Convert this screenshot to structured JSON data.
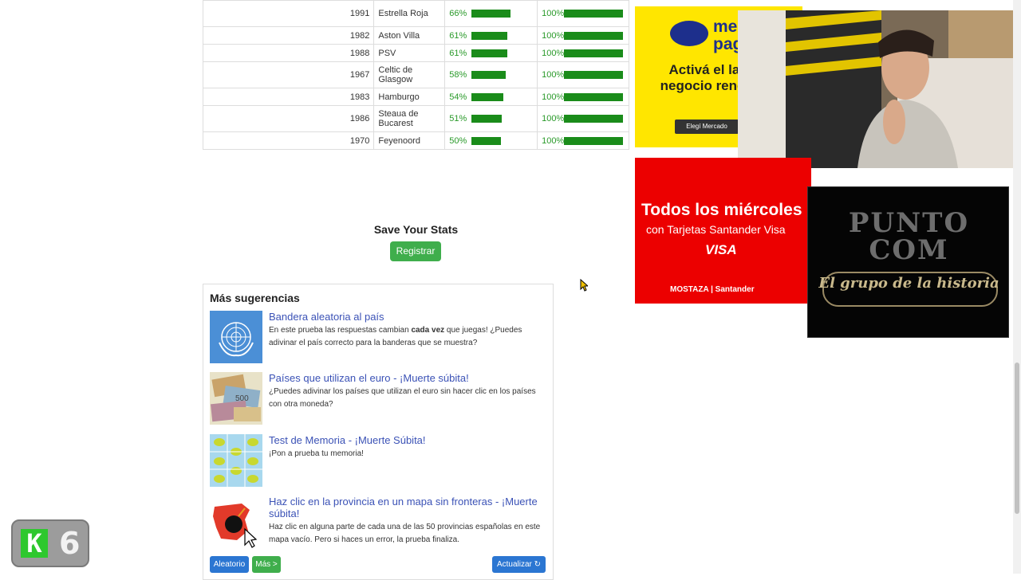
{
  "stats_table": {
    "rows": [
      {
        "year": "1991",
        "team": "Estrella Roja",
        "pct1": "66%",
        "pct1_value": 66,
        "pct2": "100%",
        "pct2_value": 100
      },
      {
        "year": "1982",
        "team": "Aston Villa",
        "pct1": "61%",
        "pct1_value": 61,
        "pct2": "100%",
        "pct2_value": 100
      },
      {
        "year": "1988",
        "team": "PSV",
        "pct1": "61%",
        "pct1_value": 61,
        "pct2": "100%",
        "pct2_value": 100
      },
      {
        "year": "1967",
        "team": "Celtic de Glasgow",
        "pct1": "58%",
        "pct1_value": 58,
        "pct2": "100%",
        "pct2_value": 100
      },
      {
        "year": "1983",
        "team": "Hamburgo",
        "pct1": "54%",
        "pct1_value": 54,
        "pct2": "100%",
        "pct2_value": 100
      },
      {
        "year": "1986",
        "team": "Steaua de Bucarest",
        "pct1": "51%",
        "pct1_value": 51,
        "pct2": "100%",
        "pct2_value": 100
      },
      {
        "year": "1970",
        "team": "Feyenoord",
        "pct1": "50%",
        "pct1_value": 50,
        "pct2": "100%",
        "pct2_value": 100
      }
    ]
  },
  "save": {
    "title": "Save Your Stats",
    "register_label": "Registrar"
  },
  "suggestions": {
    "heading": "Más sugerencias",
    "items": [
      {
        "title": "Bandera aleatoria al país",
        "desc_pre": "En este prueba las respuestas cambian ",
        "desc_bold": "cada vez",
        "desc_post": " que juegas! ¿Puedes adivinar el país correcto para la banderas que se muestra?"
      },
      {
        "title": "Países que utilizan el euro - ¡Muerte súbita!",
        "desc": "¿Puedes adivinar los países que utilizan el euro sin hacer clic en los países con otra moneda?"
      },
      {
        "title": "Test de Memoria - ¡Muerte Súbita!",
        "desc": "¡Pon a prueba tu memoria!"
      },
      {
        "title": "Haz clic en la provincia en un mapa sin fronteras - ¡Muerte súbita!",
        "desc": "Haz clic en alguna parte de cada una de las 50 provincias españolas en este mapa vacío. Pero si haces un error, la prueba finaliza."
      }
    ],
    "random_label": "Aleatorio",
    "more_label": "Más >",
    "refresh_label": "Actualizar ↻"
  },
  "ads": {
    "yellow": {
      "brand": "mercado pago",
      "headline": "Activá el lado de tu negocio rendimientos",
      "cta": "Elegí Mercado"
    },
    "red": {
      "line1": "Todos los miércoles",
      "line2": "con Tarjetas Santander Visa",
      "visa": "VISA",
      "footer": "MOSTAZA | Santander"
    }
  },
  "video_overlay": {
    "title": "PUNTO COM",
    "subtitle": "El grupo de la historia"
  },
  "channel_badge": {
    "letter": "K",
    "number": "6"
  },
  "colors": {
    "bar_green": "#1a8c1a",
    "pct_text": "#2a9a2a",
    "link_blue": "#3b52b6",
    "button_green": "#3fae4c",
    "button_blue": "#2b76d2"
  }
}
